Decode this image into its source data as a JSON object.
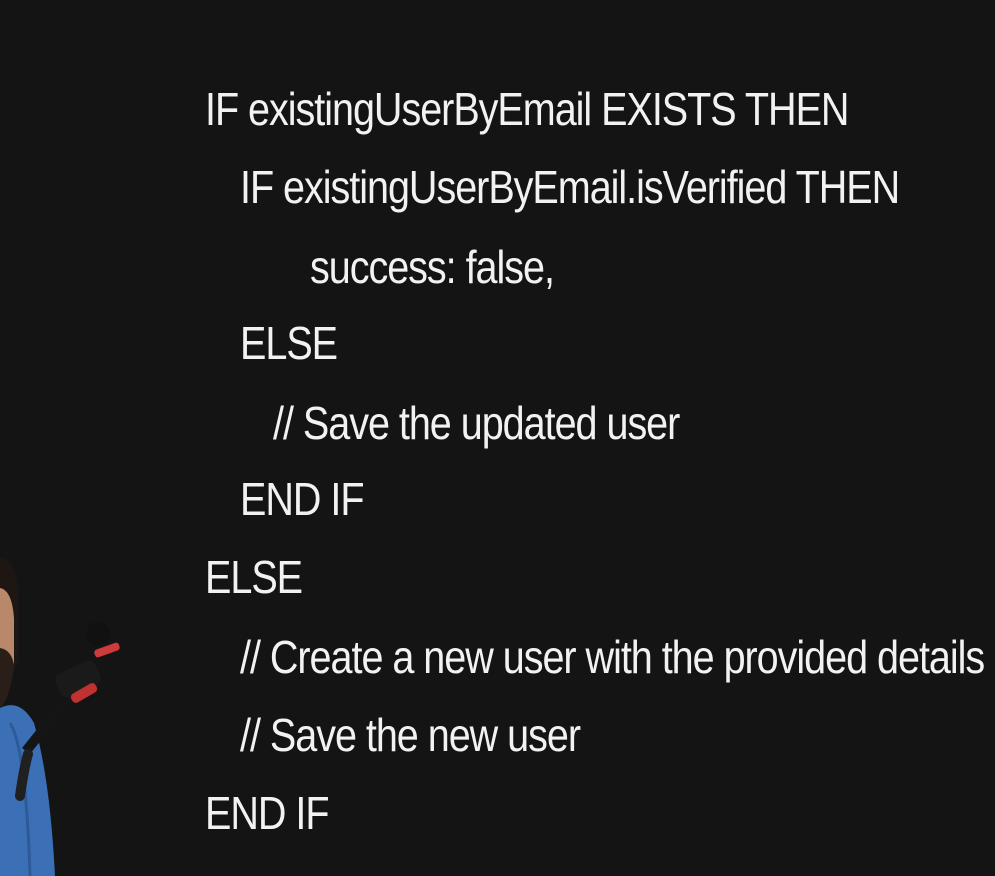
{
  "colors": {
    "background": "#141414",
    "text": "#f2f2f2",
    "shirt": "#3b6fb6",
    "mic_accent": "#d23a3a"
  },
  "code": {
    "lines": [
      "IF existingUserByEmail EXISTS THEN",
      "IF existingUserByEmail.isVerified THEN",
      "success: false,",
      "ELSE",
      "// Save the updated user",
      "END IF",
      "ELSE",
      "// Create a new user with the provided details",
      "// Save the new user",
      "END IF"
    ]
  }
}
